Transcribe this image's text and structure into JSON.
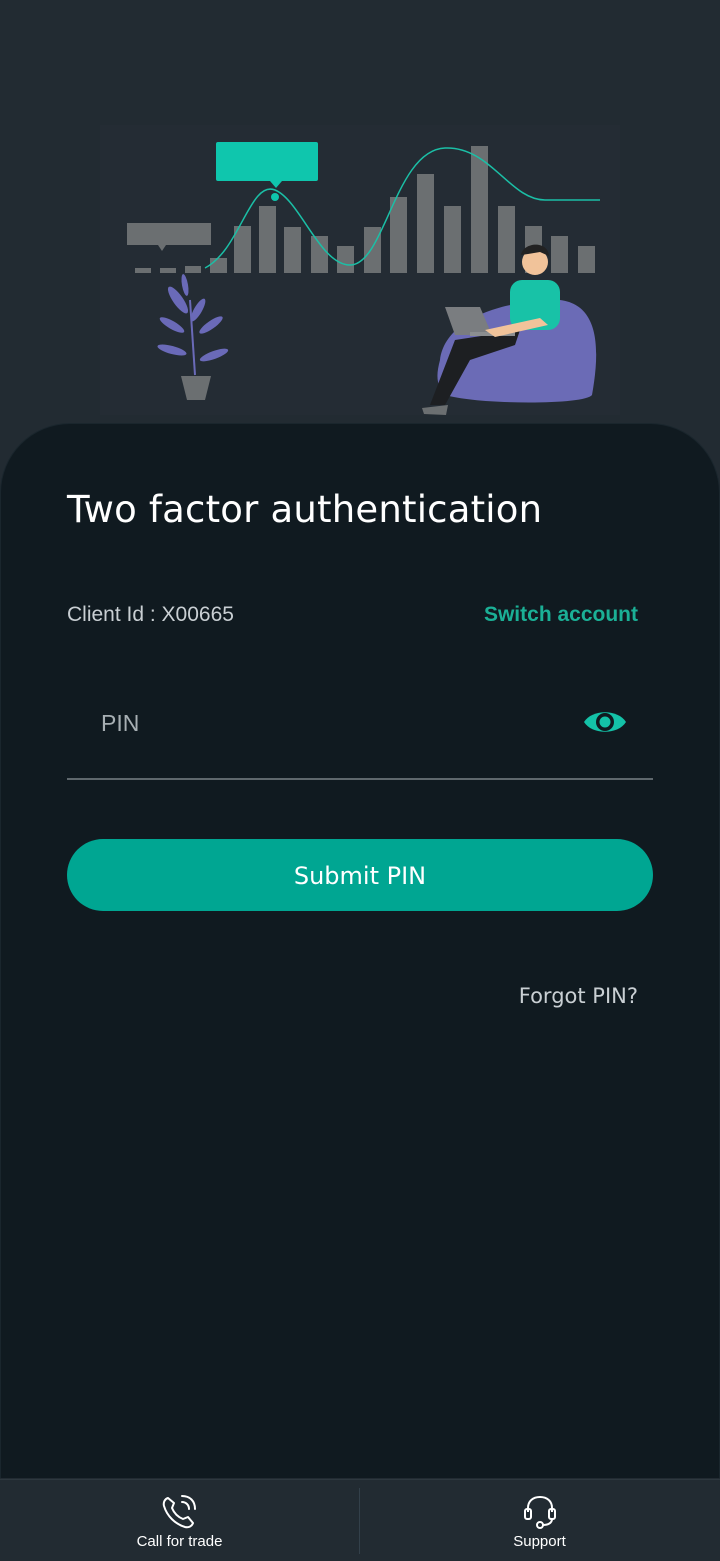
{
  "header": {
    "title": "Two factor authentication"
  },
  "account": {
    "client_id_text": "Client Id : X00665",
    "switch_label": "Switch account"
  },
  "pin": {
    "placeholder": "PIN",
    "value": ""
  },
  "actions": {
    "submit_label": "Submit PIN",
    "forgot_label": "Forgot PIN?"
  },
  "bottom_nav": {
    "call_label": "Call for trade",
    "support_label": "Support"
  },
  "colors": {
    "accent": "#00a692",
    "accent_text": "#1bb096",
    "card_bg": "#101a20",
    "page_bg": "#222b32"
  },
  "icons": {
    "eye": "eye-icon",
    "phone": "phone-call-icon",
    "support": "headset-icon"
  }
}
